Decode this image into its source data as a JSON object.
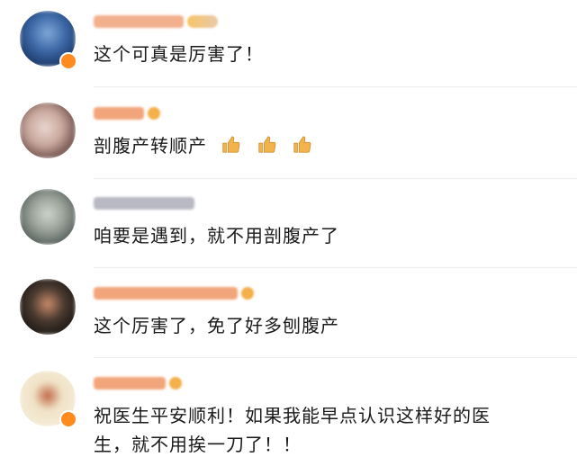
{
  "comments": [
    {
      "text": "这个可真是厉害了！"
    },
    {
      "text": "剖腹产转顺产"
    },
    {
      "text": "咱要是遇到，就不用剖腹产了"
    },
    {
      "text": "这个厉害了，免了好多刨腹产"
    },
    {
      "text_line1": "祝医生平安顺利！如果我能早点认识这样好的医",
      "text_line2": "生，就不用挨一刀了！！"
    }
  ],
  "icons": {
    "thumbs_up": "thumbs-up-emoji",
    "vip_badge": "vip-badge-icon"
  },
  "colors": {
    "name_blur": "#f2a57a",
    "name_blur_gray": "#b9b9c4",
    "badge": "#ff8a1e",
    "text": "#1a1a1a"
  }
}
